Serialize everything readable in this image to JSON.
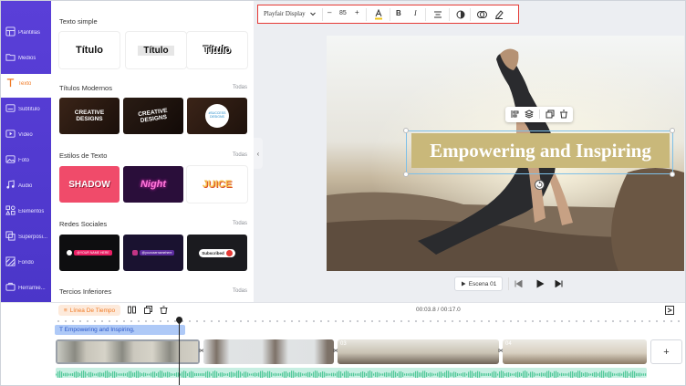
{
  "sidebar": {
    "items": [
      {
        "label": "Plantillas",
        "icon": "layout-icon"
      },
      {
        "label": "Medios",
        "icon": "folder-icon"
      },
      {
        "label": "Texto",
        "icon": "text-icon",
        "active": true
      },
      {
        "label": "Subtítulo",
        "icon": "subtitle-icon"
      },
      {
        "label": "Vídeo",
        "icon": "video-icon"
      },
      {
        "label": "Foto",
        "icon": "photo-icon"
      },
      {
        "label": "Audio",
        "icon": "music-icon"
      },
      {
        "label": "Elementos",
        "icon": "elements-icon"
      },
      {
        "label": "Superposi...",
        "icon": "overlay-icon"
      },
      {
        "label": "Fondo",
        "icon": "background-icon"
      },
      {
        "label": "Herramie...",
        "icon": "tools-icon"
      }
    ]
  },
  "panel": {
    "sections": [
      {
        "title": "Texto simple",
        "more": ""
      },
      {
        "title": "Títulos Modernos",
        "more": "Todas"
      },
      {
        "title": "Estilos de Texto",
        "more": "Todas"
      },
      {
        "title": "Redes Sociales",
        "more": "Todas"
      },
      {
        "title": "Tercios Inferiores",
        "more": "Todas"
      }
    ],
    "simple_thumbs": [
      "Título",
      "Título",
      "Título"
    ],
    "modern_thumbs": [
      "CREATIVE DESIGNS",
      "CREATIVE DESIGNS",
      "#SUCCESS DESIGNS"
    ],
    "style_thumbs": [
      "SHADOW",
      "Night",
      "JUICE"
    ],
    "social_thumbs": [
      "@YOUR NAME HERE",
      "@yourusernamehere",
      "Subscribed"
    ]
  },
  "toolbar": {
    "font": "Playfair Display",
    "size": "85",
    "minus": "–",
    "plus": "+",
    "bold": "B",
    "italic": "I"
  },
  "canvas": {
    "headline": "Empowering and Inspiring"
  },
  "player": {
    "scene_label": "Escena 01"
  },
  "timeline": {
    "mode_label": "Línea De Tiempo",
    "time": "00:03.8 / 00:17.0",
    "text_track": "Empowering  and  Inspiring,",
    "clip_numbers": [
      "03",
      "04"
    ],
    "add_label": "+"
  },
  "colors": {
    "rail": "#5a3fd8",
    "accent": "#f07a25",
    "headline_bg": "#c9b87a",
    "selection": "#7ec0e8",
    "highlight_border": "#e53935"
  }
}
